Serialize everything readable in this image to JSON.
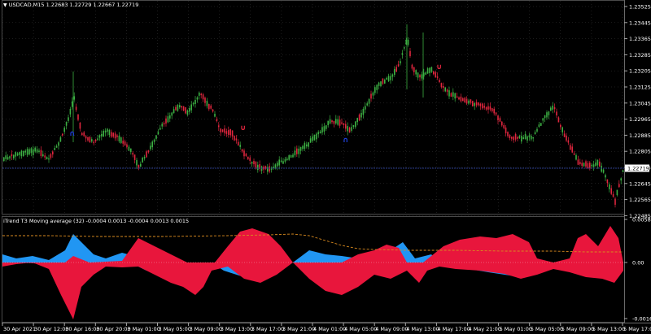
{
  "main_chart": {
    "title": "USDCAD,M15",
    "ohlc": "1.22683 1.22729 1.22667 1.22719",
    "price_labels": [
      "1.23525",
      "1.23445",
      "1.23365",
      "1.23285",
      "1.23205",
      "1.23125",
      "1.23045",
      "1.22965",
      "1.22885",
      "1.22805",
      "1.22725",
      "1.22645",
      "1.22565",
      "1.22485"
    ],
    "current_price": "1.22719",
    "arrow_glyph_up": "∩",
    "arrow_glyph_down": "∪"
  },
  "indicator": {
    "header_name": "iTrend T3 Moving average (32)",
    "header_values": "-0.0004 0.0013 -0.0004 0.0013 0.0015",
    "scale_labels": [
      "0.0058",
      "0.00",
      "-0.0016"
    ]
  },
  "time_axis": {
    "labels": [
      "30 Apr 2021",
      "30 Apr 12:00",
      "30 Apr 16:00",
      "30 Apr 20:00",
      "3 May 01:00",
      "3 May 05:00",
      "3 May 09:00",
      "3 May 13:00",
      "3 May 17:00",
      "3 May 21:00",
      "4 May 01:00",
      "4 May 05:00",
      "4 May 09:00",
      "4 May 13:00",
      "4 May 17:00",
      "4 May 21:00",
      "5 May 01:00",
      "5 May 05:00",
      "5 May 09:00",
      "5 May 13:00",
      "5 May 17:00"
    ]
  },
  "colors": {
    "background": "#000000",
    "candle_up": "#3cb043",
    "candle_down": "#e0263e",
    "area_positive": "#e8163c",
    "area_negative": "#2196f3",
    "orange_line": "#d98a1f",
    "grid": "#3a3a3a",
    "signal_up": "#1e3fd6",
    "signal_down": "#e0263e"
  }
}
